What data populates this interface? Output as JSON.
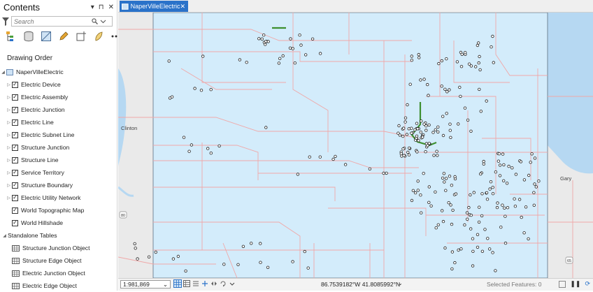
{
  "contents_pane": {
    "title": "Contents",
    "controls": {
      "dropdown": "▾",
      "pin": "⊓",
      "close": "✕"
    },
    "search_placeholder": "Search",
    "drawing_order_label": "Drawing Order",
    "map_name": "NaperVilleElectric",
    "layers": [
      "Electric Device",
      "Electric Assembly",
      "Electric Junction",
      "Electric Line",
      "Electric Subnet Line",
      "Structure Junction",
      "Structure Line",
      "Service Territory",
      "Structure Boundary",
      "Electric Utility Network"
    ],
    "basemaps": [
      "World Topographic Map",
      "World Hillshade"
    ],
    "standalone_tables_label": "Standalone Tables",
    "tables": [
      "Structure Junction Object",
      "Structure Edge Object",
      "Electric Junction Object",
      "Electric Edge Object"
    ]
  },
  "map_tab": {
    "label": "NaperVilleElectric"
  },
  "map_labels": {
    "city_left": "Clinton",
    "city_right": "Gary",
    "shield_a": "80",
    "shield_b": "65"
  },
  "status_bar": {
    "scale": "1:981,869",
    "coordinates": "86.7539182°W 41.8085992°N",
    "selected_features": "Selected Features: 0"
  },
  "colors": {
    "accent": "#2a72c9",
    "territory_fill": "#d3ecfb",
    "basemap": "#eaeaea",
    "water": "#b6d8f2",
    "roads": "#f0a8a8",
    "device_fill": "#ffffff",
    "device_stroke": "#222222"
  }
}
